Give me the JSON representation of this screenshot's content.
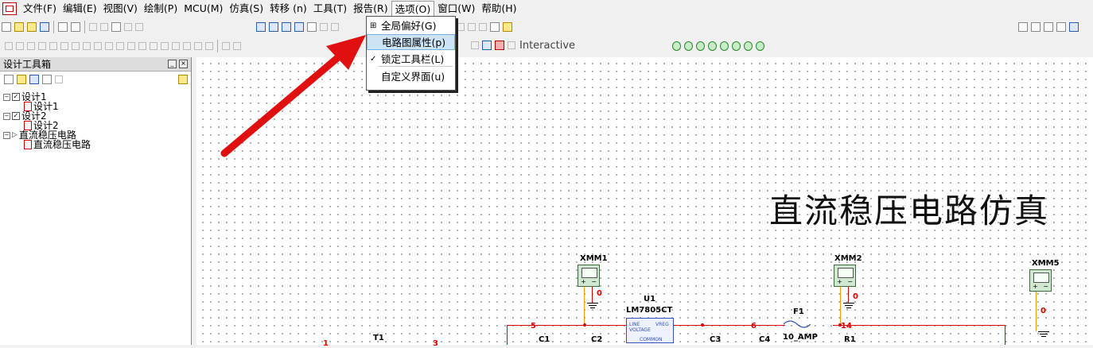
{
  "menubar": {
    "items": [
      "文件(F)",
      "编辑(E)",
      "视图(V)",
      "绘制(P)",
      "MCU(M)",
      "仿真(S)",
      "转移 (n)",
      "工具(T)",
      "报告(R)",
      "选项(O)",
      "窗口(W)",
      "帮助(H)"
    ],
    "active_index": 9
  },
  "dropdown": {
    "items": [
      {
        "label": "全局偏好(G)"
      },
      {
        "label": "电路图属性(p)"
      },
      {
        "label": "锁定工具栏(L)",
        "checked": true
      },
      {
        "label": "自定义界面(u)"
      }
    ],
    "highlighted_index": 1
  },
  "sim_toolbar": {
    "mode_label": "Interactive"
  },
  "toolbox": {
    "title": "设计工具箱",
    "tree": [
      {
        "label": "设计1",
        "level": 0,
        "kind": "project"
      },
      {
        "label": "设计1",
        "level": 1,
        "kind": "schematic"
      },
      {
        "label": "设计2",
        "level": 0,
        "kind": "project"
      },
      {
        "label": "设计2",
        "level": 1,
        "kind": "schematic"
      },
      {
        "label": "直流稳压电路",
        "level": 0,
        "kind": "project-open"
      },
      {
        "label": "直流稳压电路",
        "level": 1,
        "kind": "schematic"
      }
    ]
  },
  "canvas": {
    "title": "直流稳压电路仿真",
    "parts": {
      "xmm1": "XMM1",
      "xmm2": "XMM2",
      "xmm5": "XMM5",
      "u1": "U1",
      "u1_model": "LM7805CT",
      "u1_line": "LINE",
      "u1_vreg": "VREG",
      "u1_voltage": "VOLTAGE",
      "u1_common": "COMMON",
      "f1": "F1",
      "f1_rating": "10_AMP",
      "c1": "C1",
      "c2": "C2",
      "c3": "C3",
      "c4": "C4",
      "r1": "R1",
      "t1": "T1"
    },
    "nodes": {
      "n0a": "0",
      "n0b": "0",
      "n0c": "0",
      "n5": "5",
      "n6": "6",
      "n14": "14",
      "n1": "1",
      "n3": "3"
    }
  },
  "colors": {
    "wire": "#dd0000",
    "probe_wire": "#ff9a00",
    "arrow": "#e01010",
    "menu_highlight": "#cde4f7"
  }
}
